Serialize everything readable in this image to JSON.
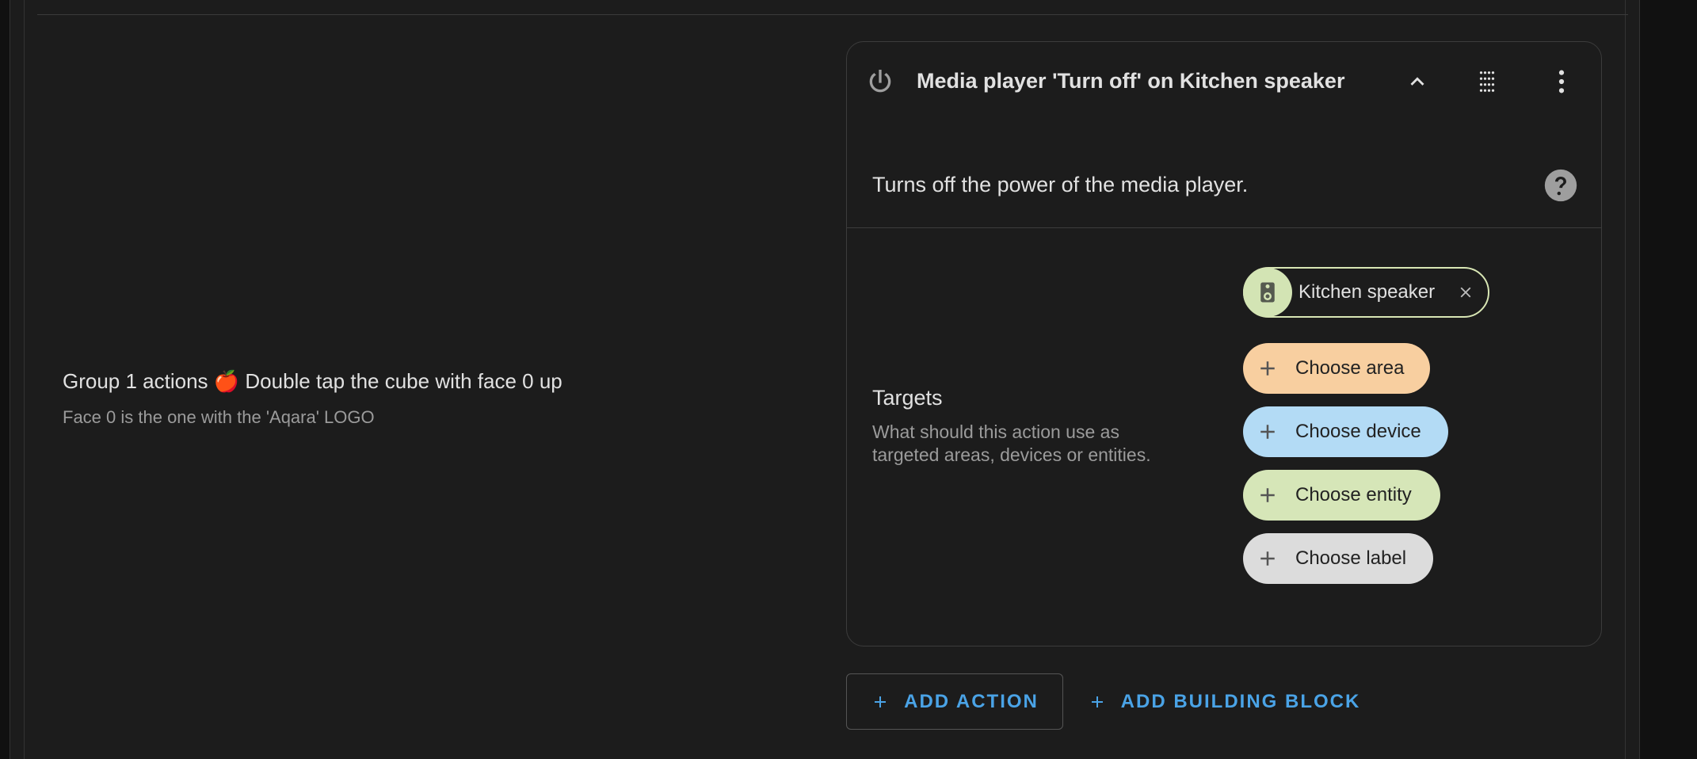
{
  "group": {
    "title": "Group 1 actions 🍎 Double tap the cube with face 0 up",
    "subtitle": "Face 0 is the one with the 'Aqara' LOGO"
  },
  "action_card": {
    "title": "Media player 'Turn off' on Kitchen speaker",
    "icon": "power-icon",
    "description": "Turns off the power of the media player.",
    "targets": {
      "title": "Targets",
      "description": "What should this action use as targeted areas, devices or entities.",
      "selected": {
        "name": "Kitchen speaker",
        "icon": "speaker-icon"
      },
      "choose_area": "Choose area",
      "choose_device": "Choose device",
      "choose_entity": "Choose entity",
      "choose_label": "Choose label"
    }
  },
  "buttons": {
    "add_action": "ADD ACTION",
    "add_building_block": "ADD BUILDING BLOCK"
  },
  "colors": {
    "background": "#1c1c1c",
    "accent": "#4aa3e6",
    "area_chip": "#f8cfa0",
    "device_chip": "#b3dbf5",
    "entity_chip": "#d6e6b8",
    "label_chip": "#dcdcdc"
  }
}
